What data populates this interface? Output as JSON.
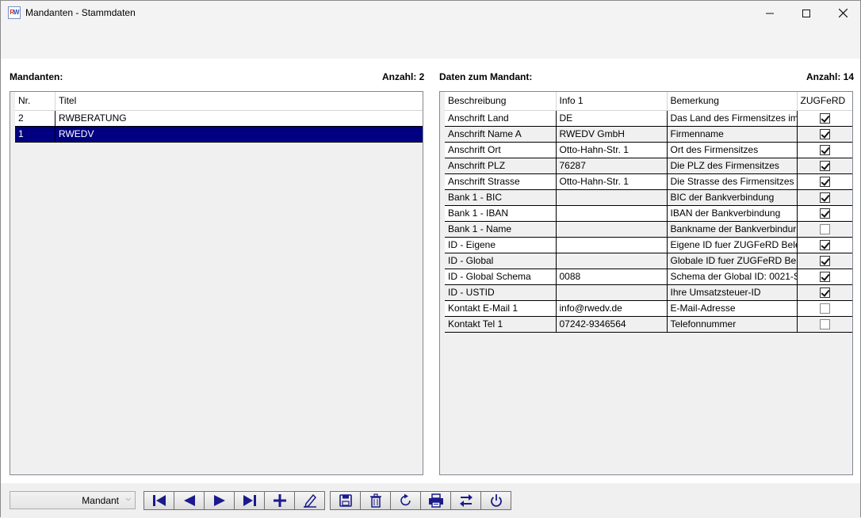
{
  "window": {
    "title": "Mandanten - Stammdaten",
    "icon_text_r": "R",
    "icon_text_w": "W"
  },
  "left": {
    "label": "Mandanten:",
    "count": "Anzahl: 2",
    "columns": [
      "Nr.",
      "Titel"
    ],
    "rows": [
      {
        "nr": "2",
        "titel": "RWBERATUNG"
      },
      {
        "nr": "1",
        "titel": "RWEDV"
      }
    ]
  },
  "right": {
    "label": "Daten zum Mandant:",
    "count": "Anzahl: 14",
    "columns": [
      "Beschreibung",
      "Info 1",
      "Bemerkung",
      "ZUGFeRD"
    ],
    "rows": [
      {
        "beschreibung": "Anschrift Land",
        "info": "DE",
        "bemerkung": "Das Land des Firmensitzes im",
        "zugferd": true
      },
      {
        "beschreibung": "Anschrift Name A",
        "info": "RWEDV GmbH",
        "bemerkung": "Firmenname",
        "zugferd": true
      },
      {
        "beschreibung": "Anschrift Ort",
        "info": "Otto-Hahn-Str. 1",
        "bemerkung": "Ort des Firmensitzes",
        "zugferd": true
      },
      {
        "beschreibung": "Anschrift PLZ",
        "info": "76287",
        "bemerkung": "Die PLZ des Firmensitzes",
        "zugferd": true
      },
      {
        "beschreibung": "Anschrift Strasse",
        "info": "Otto-Hahn-Str. 1",
        "bemerkung": "Die Strasse des Firmensitzes",
        "zugferd": true
      },
      {
        "beschreibung": "Bank 1 - BIC",
        "info": "",
        "bemerkung": "BIC der Bankverbindung",
        "zugferd": true
      },
      {
        "beschreibung": "Bank 1 - IBAN",
        "info": "",
        "bemerkung": "IBAN der Bankverbindung",
        "zugferd": true
      },
      {
        "beschreibung": "Bank 1 - Name",
        "info": "",
        "bemerkung": "Bankname der Bankverbindur",
        "zugferd": false
      },
      {
        "beschreibung": "ID - Eigene",
        "info": "",
        "bemerkung": "Eigene ID fuer ZUGFeRD Bele(",
        "zugferd": true
      },
      {
        "beschreibung": "ID - Global",
        "info": "",
        "bemerkung": "Globale ID fuer ZUGFeRD Bele",
        "zugferd": true
      },
      {
        "beschreibung": "ID - Global Schema",
        "info": "0088",
        "bemerkung": "Schema der Global ID: 0021-S",
        "zugferd": true
      },
      {
        "beschreibung": "ID - USTID",
        "info": "",
        "bemerkung": "Ihre Umsatzsteuer-ID",
        "zugferd": true
      },
      {
        "beschreibung": "Kontakt E-Mail 1",
        "info": "info@rwedv.de",
        "bemerkung": "E-Mail-Adresse",
        "zugferd": false
      },
      {
        "beschreibung": "Kontakt Tel 1",
        "info": "07242-9346564",
        "bemerkung": "Telefonnummer",
        "zugferd": false
      }
    ]
  },
  "bottom": {
    "combo_value": "Mandant",
    "buttons": [
      {
        "name": "first-record-button",
        "icon": "first-icon"
      },
      {
        "name": "previous-record-button",
        "icon": "previous-icon"
      },
      {
        "name": "next-record-button",
        "icon": "next-icon"
      },
      {
        "name": "last-record-button",
        "icon": "last-icon"
      },
      {
        "name": "add-button",
        "icon": "plus-icon"
      },
      {
        "name": "edit-button",
        "icon": "pencil-icon"
      },
      {
        "name": "save-button",
        "icon": "floppy-icon"
      },
      {
        "name": "delete-button",
        "icon": "trash-icon"
      },
      {
        "name": "refresh-button",
        "icon": "refresh-icon"
      },
      {
        "name": "print-button",
        "icon": "printer-icon"
      },
      {
        "name": "switch-button",
        "icon": "swap-icon"
      },
      {
        "name": "exit-button",
        "icon": "power-icon"
      }
    ]
  },
  "colors": {
    "selection": "#000080",
    "icon": "#1a1a8c"
  }
}
